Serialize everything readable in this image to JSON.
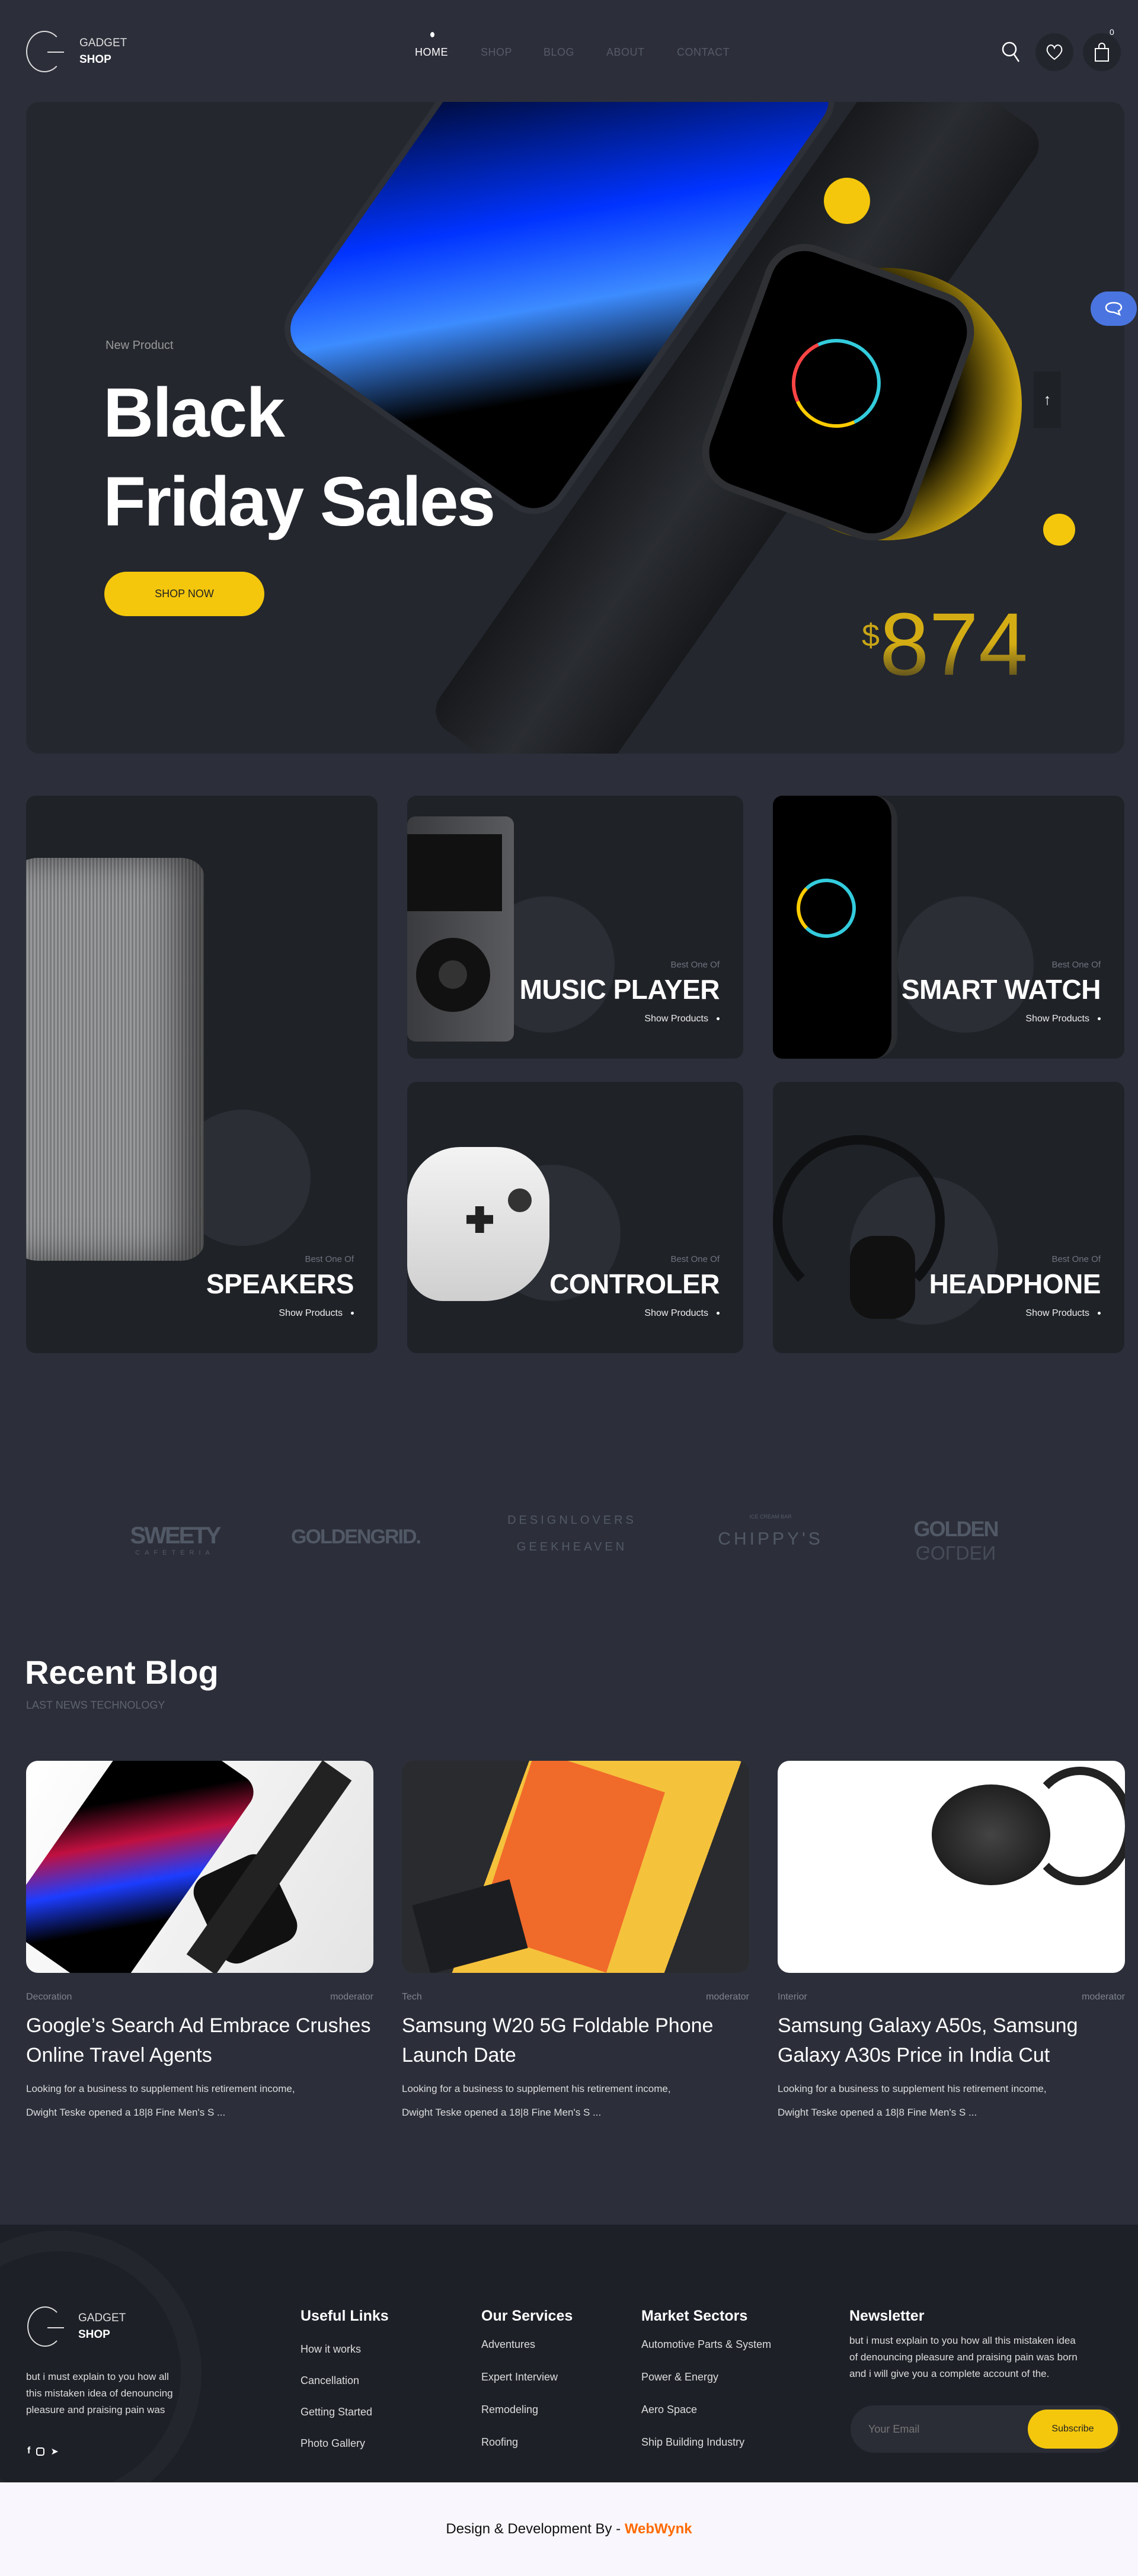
{
  "header": {
    "logo": {
      "line1": "GADGET",
      "line2": "SHOP"
    },
    "nav": [
      {
        "label": "HOME",
        "active": true
      },
      {
        "label": "SHOP"
      },
      {
        "label": "BLOG"
      },
      {
        "label": "ABOUT"
      },
      {
        "label": "CONTACT"
      }
    ],
    "icons": [
      "search-icon",
      "heart-icon",
      "shopping-bag-icon"
    ],
    "cart_count": "0"
  },
  "hero": {
    "eyebrow": "New Product",
    "title_line1": "Black",
    "title_line2": "Friday Sales",
    "cta": "SHOP NOW",
    "currency": "$",
    "price": "874"
  },
  "categories": [
    {
      "best": "Best One Of",
      "name": "SPEAKERS",
      "link": "Show Products"
    },
    {
      "best": "Best One Of",
      "name": "MUSIC PLAYER",
      "link": "Show Products"
    },
    {
      "best": "Best One Of",
      "name": "SMART WATCH",
      "link": "Show Products"
    },
    {
      "best": "Best One Of",
      "name": "CONTROLER",
      "link": "Show Products"
    },
    {
      "best": "Best One Of",
      "name": "HEADPHONE",
      "link": "Show Products"
    }
  ],
  "brands": [
    {
      "name": "SWEETY",
      "sub": "CAFETERIA"
    },
    {
      "name": "GOLDENGRID."
    },
    {
      "name": "DESIGNLOVERS",
      "sub": "GEEKHEAVEN"
    },
    {
      "name": "CHIPPY'S",
      "sub": "ICE CREAM BAR"
    },
    {
      "name": "GOLDEN",
      "sub": "GOLDEN"
    }
  ],
  "blog": {
    "title": "Recent Blog",
    "subtitle": "LAST NEWS TECHNOLOGY",
    "posts": [
      {
        "category": "Decoration",
        "author": "moderator",
        "title": "Google’s Search Ad Embrace Crushes Online Travel Agents",
        "desc_line1": "Looking for a business to supplement his retirement income,",
        "desc_line2": "Dwight Teske opened a 18|8 Fine Men's S ..."
      },
      {
        "category": "Tech",
        "author": "moderator",
        "title": "Samsung W20 5G Foldable Phone Launch Date",
        "desc_line1": "Looking for a business to supplement his retirement income,",
        "desc_line2": "Dwight Teske opened a 18|8 Fine Men's S ..."
      },
      {
        "category": "Interior",
        "author": "moderator",
        "title": "Samsung Galaxy A50s, Samsung Galaxy A30s Price in India Cut",
        "desc_line1": "Looking for a business to supplement his retirement income,",
        "desc_line2": "Dwight Teske opened a 18|8 Fine Men's S ..."
      }
    ]
  },
  "footer": {
    "logo": {
      "line1": "GADGET",
      "line2": "SHOP"
    },
    "about_lines": [
      "but i must explain to you how all",
      "this mistaken idea of denouncing",
      "pleasure and praising pain was"
    ],
    "social": [
      "facebook-icon",
      "instagram-icon",
      "telegram-icon"
    ],
    "useful_links": {
      "title": "Useful Links",
      "items": [
        "How it works",
        "Cancellation",
        "Getting Started",
        "Photo Gallery"
      ]
    },
    "services": {
      "title": "Our Services",
      "items": [
        "Adventures",
        "Expert Interview",
        "Remodeling",
        "Roofing"
      ]
    },
    "sectors": {
      "title": "Market Sectors",
      "items": [
        "Automotive Parts & System",
        "Power & Energy",
        "Aero Space",
        "Ship Building Industry"
      ]
    },
    "newsletter": {
      "title": "Newsletter",
      "lines": [
        "but i must explain to you how all this mistaken idea",
        "of denouncing pleasure and praising pain was born",
        "and i will give you a complete account of the."
      ],
      "placeholder": "Your Email",
      "button": "Subscribe"
    }
  },
  "credit": {
    "text": "Design & Development By - ",
    "brand": "WebWynk"
  },
  "colors": {
    "accent": "#f4c70c",
    "page": "#2c2f3a",
    "card": "#1f2227",
    "chat": "#4a75e0",
    "credit_brand": "#ff6a00"
  }
}
